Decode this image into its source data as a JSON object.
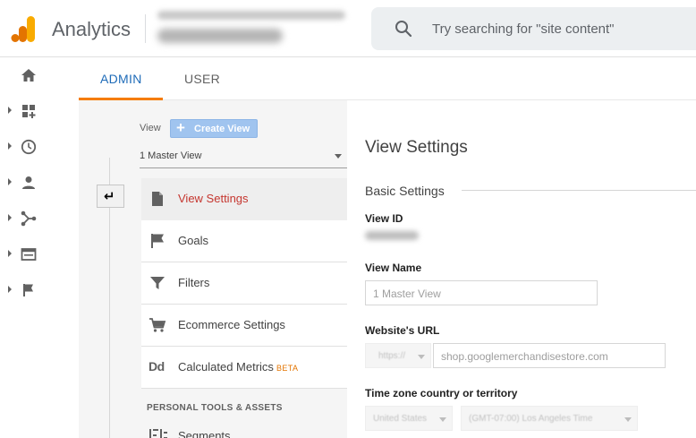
{
  "header": {
    "brand": "Analytics",
    "search_placeholder": "Try searching for \"site content\""
  },
  "tabs": {
    "admin": "ADMIN",
    "user": "USER",
    "active": "ADMIN"
  },
  "view_column": {
    "view_label": "View",
    "create_view_label": "Create View",
    "selected_view": "1 Master View",
    "menu": [
      {
        "label": "View Settings",
        "icon": "document-icon",
        "active": true
      },
      {
        "label": "Goals",
        "icon": "flag-icon",
        "active": false
      },
      {
        "label": "Filters",
        "icon": "funnel-icon",
        "active": false
      },
      {
        "label": "Ecommerce Settings",
        "icon": "cart-icon",
        "active": false
      },
      {
        "label": "Calculated Metrics",
        "badge": "BETA",
        "icon": "dd-icon",
        "active": false
      }
    ],
    "section_header": "PERSONAL TOOLS & ASSETS",
    "segments_label": "Segments"
  },
  "settings": {
    "title": "View Settings",
    "section": "Basic Settings",
    "view_id_label": "View ID",
    "view_name_label": "View Name",
    "view_name_value": "1 Master View",
    "website_url_label": "Website's URL",
    "protocol": "https://",
    "website_url_value": "shop.googlemerchandisestore.com",
    "timezone_label": "Time zone country or territory",
    "country": "United States",
    "timezone": "(GMT-07:00) Los Angeles Time"
  },
  "colors": {
    "accent_blue": "#1e6bb8",
    "tab_underline": "#f57c00",
    "active_item": "#c5362f",
    "logo_orange": "#f9ab00",
    "logo_dark": "#e37400"
  }
}
